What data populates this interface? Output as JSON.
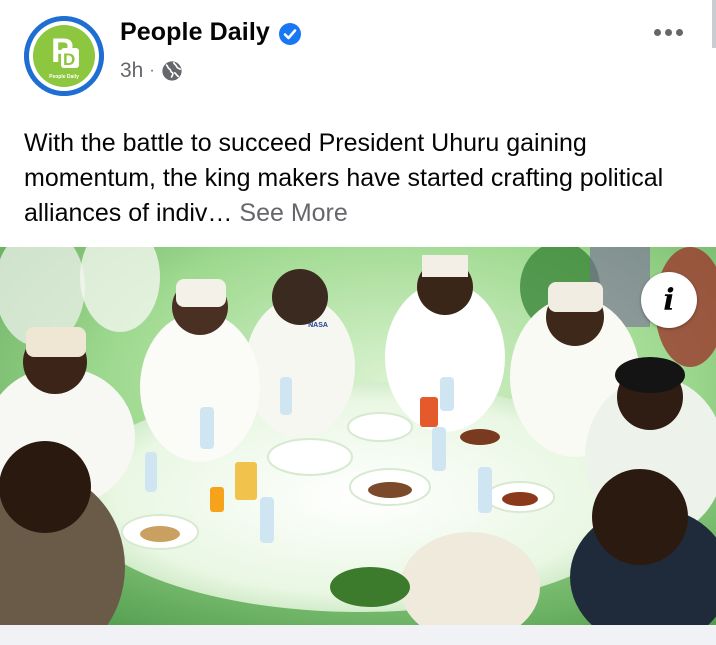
{
  "post": {
    "page_name": "People Daily",
    "timestamp": "3h",
    "separator": "·",
    "audience_icon": "globe-icon",
    "verified_icon": "verified-badge-icon",
    "more_icon": "more-options-icon",
    "text": "With the battle to succeed President Uhuru gaining momentum, the king makers have started crafting political alliances of indiv…",
    "see_more_label": "See More"
  },
  "avatar": {
    "logo_letters": "PD",
    "logo_caption": "People Daily"
  },
  "photo": {
    "info_icon": "info-icon",
    "info_glyph": "i",
    "sign_text": "NASA"
  },
  "colors": {
    "verified_blue": "#1877f2",
    "secondary_text": "#65676b",
    "primary_text": "#050505",
    "logo_green": "#8dc63f",
    "logo_ring": "#1f6fd3"
  }
}
